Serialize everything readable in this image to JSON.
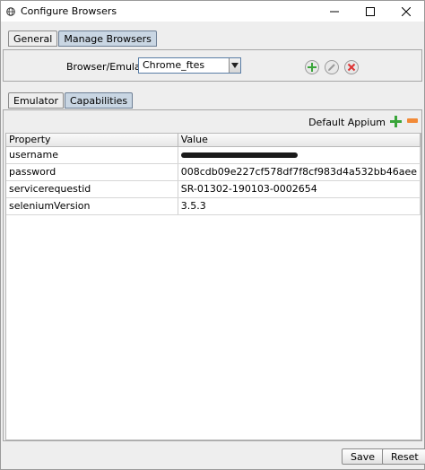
{
  "window": {
    "title": "Configure Browsers"
  },
  "tabs_top": [
    {
      "label": "General",
      "selected": false
    },
    {
      "label": "Manage Browsers",
      "selected": true
    }
  ],
  "browser_emulator": {
    "label": "Browser/Emulator",
    "value": "Chrome_ftes"
  },
  "tabs_lower": [
    {
      "label": "Emulator",
      "selected": false
    },
    {
      "label": "Capabilities",
      "selected": true
    }
  ],
  "capabilities": {
    "default_label": "Default Appium",
    "columns": [
      "Property",
      "Value"
    ],
    "rows": [
      {
        "property": "username",
        "value": "",
        "redacted": true
      },
      {
        "property": "password",
        "value": "008cdb09e227cf578df7f8cf983d4a532bb46aee",
        "redacted": false
      },
      {
        "property": "servicerequestid",
        "value": "SR-01302-190103-0002654",
        "redacted": false
      },
      {
        "property": "seleniumVersion",
        "value": "3.5.3",
        "redacted": false
      }
    ]
  },
  "buttons": {
    "save": "Save",
    "reset": "Reset"
  },
  "colors": {
    "selected_tab": "#c9d6e3",
    "add_green": "#3aa53a",
    "remove_red": "#d33",
    "remove_orange": "#f28a37"
  }
}
